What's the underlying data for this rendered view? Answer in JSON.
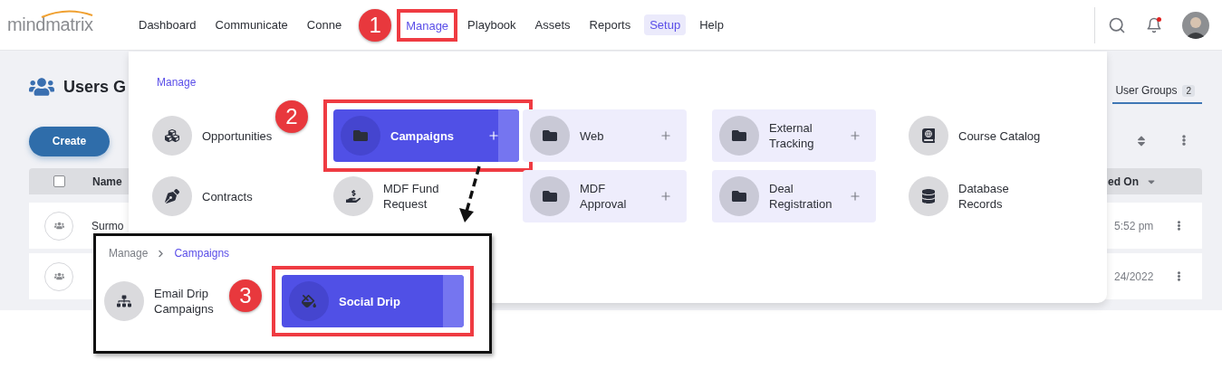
{
  "nav": {
    "logo": "mindmatrix",
    "notification_unread": true,
    "items": [
      {
        "label": "Dashboard",
        "selected": false,
        "open": false
      },
      {
        "label": "Communicate",
        "selected": false,
        "open": false
      },
      {
        "label": "Conne",
        "selected": false,
        "open": false
      },
      {
        "label": "Manage",
        "selected": false,
        "open": true,
        "annotation": "1"
      },
      {
        "label": "Playbook",
        "selected": false,
        "open": false
      },
      {
        "label": "Assets",
        "selected": false,
        "open": false
      },
      {
        "label": "Reports",
        "selected": false,
        "open": false
      },
      {
        "label": "Setup",
        "selected": true,
        "open": false
      },
      {
        "label": "Help",
        "selected": false,
        "open": false
      }
    ]
  },
  "page": {
    "title": "Users G",
    "create_button": "Create",
    "tab": {
      "label": "User Groups",
      "count": "2",
      "selected": true
    },
    "table": {
      "header_checkbox": {
        "checked": false
      },
      "columns": [
        "Name",
        "ed On"
      ],
      "rows": [
        {
          "name": "Surmo",
          "date": "5:52 pm"
        },
        {
          "date": "24/2022"
        }
      ]
    }
  },
  "menu": {
    "breadcrumb": "Manage",
    "items": [
      {
        "label": "Opportunities",
        "kind": "link",
        "selected": false
      },
      {
        "label": "Campaigns",
        "kind": "folder",
        "selected": true,
        "annotation": "2"
      },
      {
        "label": "Web",
        "kind": "folder",
        "selected": false
      },
      {
        "label": "External Tracking",
        "kind": "folder",
        "selected": false
      },
      {
        "label": "Course Catalog",
        "kind": "link",
        "selected": false
      },
      {
        "label": "Contracts",
        "kind": "link",
        "selected": false
      },
      {
        "label": "MDF Fund Request",
        "kind": "link",
        "selected": false
      },
      {
        "label": "MDF Approval",
        "kind": "folder",
        "selected": false
      },
      {
        "label": "Deal Registration",
        "kind": "folder",
        "selected": false
      },
      {
        "label": "Database Records",
        "kind": "link",
        "selected": false
      }
    ]
  },
  "submenu": {
    "breadcrumb": [
      "Manage",
      "Campaigns"
    ],
    "items": [
      {
        "label": "Email Drip Campaigns",
        "kind": "link",
        "selected": false
      },
      {
        "label": "Social Drip",
        "kind": "card",
        "selected": true,
        "annotation": "3"
      }
    ]
  }
}
